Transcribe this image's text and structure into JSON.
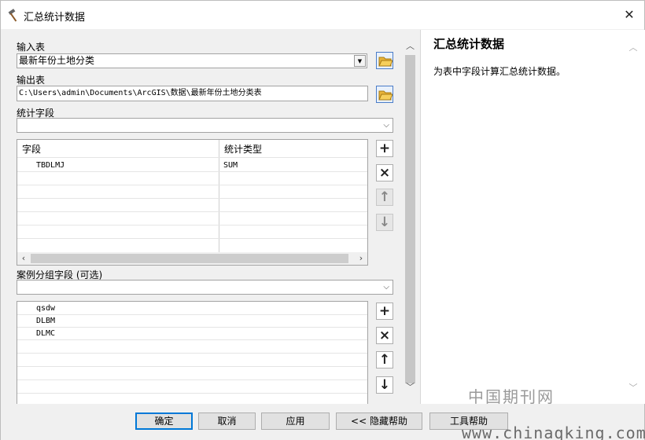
{
  "window": {
    "title": "汇总统计数据",
    "close_glyph": "✕"
  },
  "left": {
    "input_table_label": "输入表",
    "input_table_value": "最新年份土地分类",
    "output_table_label": "输出表",
    "output_table_value": "C:\\Users\\admin\\Documents\\ArcGIS\\数据\\最新年份土地分类表",
    "stat_field_label": "统计字段",
    "stat_field_value": "",
    "stats_grid": {
      "headers": [
        "字段",
        "统计类型"
      ],
      "rows": [
        {
          "field": "TBDLMJ",
          "type": "SUM"
        }
      ]
    },
    "case_field_label": "案例分组字段 (可选)",
    "case_field_value": "",
    "case_list": [
      "qsdw",
      "DLBM",
      "DLMC"
    ],
    "tools": {
      "add": "+",
      "remove": "×",
      "up": "↑",
      "down": "↓"
    }
  },
  "help": {
    "title": "汇总统计数据",
    "text": "为表中字段计算汇总统计数据。",
    "watermark": "中国期刊网"
  },
  "buttons": {
    "ok": "确定",
    "cancel": "取消",
    "apply": "应用",
    "hide_help": "<< 隐藏帮助",
    "tool_help": "工具帮助"
  },
  "footer_watermark": "www.chinaqking.com",
  "colors": {
    "accent": "#0078d7",
    "folder": "#e8b43a"
  },
  "icons": {
    "title": "hammer-icon",
    "folder": "folder-open-icon"
  }
}
